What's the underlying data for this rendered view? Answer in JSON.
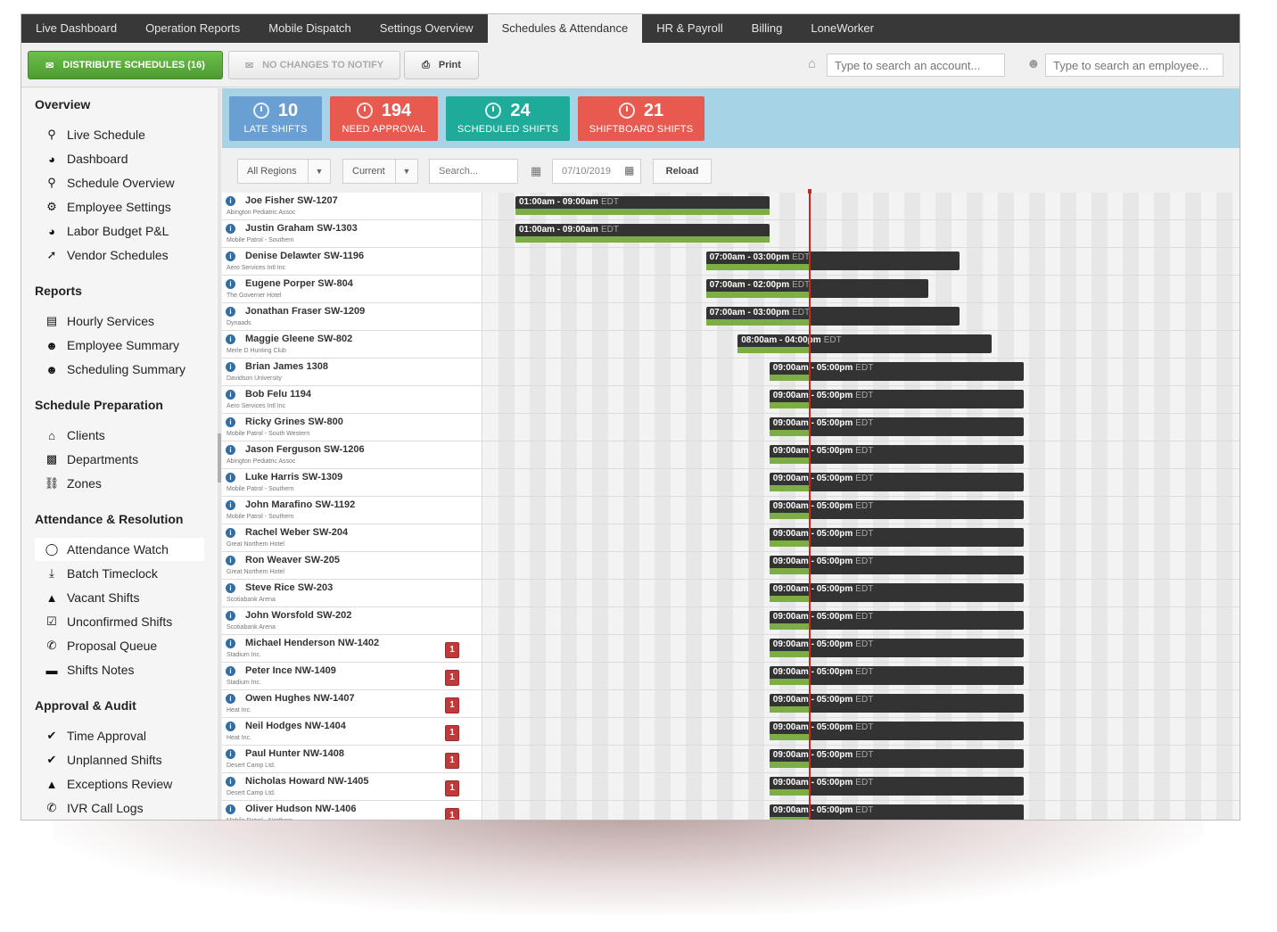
{
  "nav": {
    "tabs": [
      {
        "label": "Live Dashboard"
      },
      {
        "label": "Operation Reports"
      },
      {
        "label": "Mobile Dispatch"
      },
      {
        "label": "Settings Overview"
      },
      {
        "label": "Schedules & Attendance",
        "active": true
      },
      {
        "label": "HR & Payroll"
      },
      {
        "label": "Billing"
      },
      {
        "label": "LoneWorker"
      }
    ]
  },
  "toolbar": {
    "distribute_label": "DISTRIBUTE SCHEDULES (16)",
    "no_changes_label": "NO CHANGES TO NOTIFY",
    "print_label": "Print",
    "account_search_placeholder": "Type to search an account...",
    "employee_search_placeholder": "Type to search an employee..."
  },
  "sidebar": {
    "sections": [
      {
        "title": "Overview",
        "items": [
          {
            "label": "Live Schedule",
            "icon": "search-icon"
          },
          {
            "label": "Dashboard",
            "icon": "pie-chart-icon"
          },
          {
            "label": "Schedule Overview",
            "icon": "search-icon"
          },
          {
            "label": "Employee Settings",
            "icon": "gear-icon"
          },
          {
            "label": "Labor Budget P&L",
            "icon": "pie-chart-icon"
          },
          {
            "label": "Vendor Schedules",
            "icon": "share-icon"
          }
        ]
      },
      {
        "title": "Reports",
        "items": [
          {
            "label": "Hourly Services",
            "icon": "list-icon"
          },
          {
            "label": "Employee Summary",
            "icon": "user-icon"
          },
          {
            "label": "Scheduling Summary",
            "icon": "user-icon"
          }
        ]
      },
      {
        "title": "Schedule Preparation",
        "items": [
          {
            "label": "Clients",
            "icon": "home-icon"
          },
          {
            "label": "Departments",
            "icon": "building-icon"
          },
          {
            "label": "Zones",
            "icon": "car-icon"
          }
        ]
      },
      {
        "title": "Attendance & Resolution",
        "items": [
          {
            "label": "Attendance Watch",
            "icon": "eye-icon",
            "active": true
          },
          {
            "label": "Batch Timeclock",
            "icon": "download-icon"
          },
          {
            "label": "Vacant Shifts",
            "icon": "warning-icon"
          },
          {
            "label": "Unconfirmed Shifts",
            "icon": "checkbox-icon"
          },
          {
            "label": "Proposal Queue",
            "icon": "phone-icon"
          },
          {
            "label": "Shifts Notes",
            "icon": "folder-icon"
          }
        ]
      },
      {
        "title": "Approval & Audit",
        "items": [
          {
            "label": "Time Approval",
            "icon": "check-icon"
          },
          {
            "label": "Unplanned Shifts",
            "icon": "check-icon"
          },
          {
            "label": "Exceptions Review",
            "icon": "warning-icon"
          },
          {
            "label": "IVR Call Logs",
            "icon": "phone-icon"
          }
        ]
      }
    ]
  },
  "stats": [
    {
      "number": "10",
      "label": "LATE SHIFTS",
      "color": "#6a9fd3",
      "icon": "clock-icon"
    },
    {
      "number": "194",
      "label": "NEED APPROVAL",
      "color": "#e85a4f",
      "icon": "pie-chart-icon"
    },
    {
      "number": "24",
      "label": "SCHEDULED SHIFTS",
      "color": "#1fab9a",
      "icon": "clock-icon"
    },
    {
      "number": "21",
      "label": "SHIFTBOARD SHIFTS",
      "color": "#e85a4f",
      "icon": "clock-icon"
    }
  ],
  "filters": {
    "region": "All Regions",
    "period": "Current",
    "search_placeholder": "Search...",
    "date": "07/10/2019",
    "reload_label": "Reload"
  },
  "shifts": [
    {
      "name": "Joe Fisher SW-1207",
      "location": "Abington Pediatric Assoc",
      "time": "01:00am - 09:00am",
      "tz": "EDT",
      "start": 1,
      "end": 9,
      "badge": ""
    },
    {
      "name": "Justin Graham SW-1303",
      "location": "Mobile Patrol - Southern",
      "time": "01:00am - 09:00am",
      "tz": "EDT",
      "start": 1,
      "end": 9,
      "badge": ""
    },
    {
      "name": "Denise Delawter SW-1196",
      "location": "Aero Services Intl Inc",
      "time": "07:00am - 03:00pm",
      "tz": "EDT",
      "start": 7,
      "end": 15,
      "badge": ""
    },
    {
      "name": "Eugene Porper SW-804",
      "location": "The Governer Hotel",
      "time": "07:00am - 02:00pm",
      "tz": "EDT",
      "start": 7,
      "end": 14,
      "badge": ""
    },
    {
      "name": "Jonathan Fraser SW-1209",
      "location": "Dynaads",
      "time": "07:00am - 03:00pm",
      "tz": "EDT",
      "start": 7,
      "end": 15,
      "badge": ""
    },
    {
      "name": "Maggie Gleene SW-802",
      "location": "Merle D Hunting Club",
      "time": "08:00am - 04:00pm",
      "tz": "EDT",
      "start": 8,
      "end": 16,
      "badge": ""
    },
    {
      "name": "Brian James 1308",
      "location": "Davidson University",
      "time": "09:00am - 05:00pm",
      "tz": "EDT",
      "start": 9,
      "end": 17,
      "badge": ""
    },
    {
      "name": "Bob Felu 1194",
      "location": "Aero Services Intl Inc",
      "time": "09:00am - 05:00pm",
      "tz": "EDT",
      "start": 9,
      "end": 17,
      "badge": ""
    },
    {
      "name": "Ricky Grines SW-800",
      "location": "Mobile Patrol - South Western",
      "time": "09:00am - 05:00pm",
      "tz": "EDT",
      "start": 9,
      "end": 17,
      "badge": ""
    },
    {
      "name": "Jason Ferguson SW-1206",
      "location": "Abington Pediatric Assoc",
      "time": "09:00am - 05:00pm",
      "tz": "EDT",
      "start": 9,
      "end": 17,
      "badge": ""
    },
    {
      "name": "Luke Harris SW-1309",
      "location": "Mobile Patrol - Southern",
      "time": "09:00am - 05:00pm",
      "tz": "EDT",
      "start": 9,
      "end": 17,
      "badge": ""
    },
    {
      "name": "John Marafino SW-1192",
      "location": "Mobile Patrol - Southern",
      "time": "09:00am - 05:00pm",
      "tz": "EDT",
      "start": 9,
      "end": 17,
      "badge": ""
    },
    {
      "name": "Rachel Weber SW-204",
      "location": "Great Northern Hotel",
      "time": "09:00am - 05:00pm",
      "tz": "EDT",
      "start": 9,
      "end": 17,
      "badge": ""
    },
    {
      "name": "Ron Weaver SW-205",
      "location": "Great Northern Hotel",
      "time": "09:00am - 05:00pm",
      "tz": "EDT",
      "start": 9,
      "end": 17,
      "badge": ""
    },
    {
      "name": "Steve Rice SW-203",
      "location": "Scotiabank Arena",
      "time": "09:00am - 05:00pm",
      "tz": "EDT",
      "start": 9,
      "end": 17,
      "badge": ""
    },
    {
      "name": "John Worsfold SW-202",
      "location": "Scotiabank Arena",
      "time": "09:00am - 05:00pm",
      "tz": "EDT",
      "start": 9,
      "end": 17,
      "badge": ""
    },
    {
      "name": "Michael Henderson NW-1402",
      "location": "Stadium Inc.",
      "time": "09:00am - 05:00pm",
      "tz": "EDT",
      "start": 9,
      "end": 17,
      "badge": "1"
    },
    {
      "name": "Peter Ince NW-1409",
      "location": "Stadium Inc.",
      "time": "09:00am - 05:00pm",
      "tz": "EDT",
      "start": 9,
      "end": 17,
      "badge": "1"
    },
    {
      "name": "Owen Hughes NW-1407",
      "location": "Heat Inc.",
      "time": "09:00am - 05:00pm",
      "tz": "EDT",
      "start": 9,
      "end": 17,
      "badge": "1"
    },
    {
      "name": "Neil Hodges NW-1404",
      "location": "Heat Inc.",
      "time": "09:00am - 05:00pm",
      "tz": "EDT",
      "start": 9,
      "end": 17,
      "badge": "1"
    },
    {
      "name": "Paul Hunter NW-1408",
      "location": "Desert Camp Ltd.",
      "time": "09:00am - 05:00pm",
      "tz": "EDT",
      "start": 9,
      "end": 17,
      "badge": "1"
    },
    {
      "name": "Nicholas Howard NW-1405",
      "location": "Desert Camp Ltd.",
      "time": "09:00am - 05:00pm",
      "tz": "EDT",
      "start": 9,
      "end": 17,
      "badge": "1"
    },
    {
      "name": "Oliver Hudson NW-1406",
      "location": "Mobile Patrol - Northern",
      "time": "09:00am - 05:00pm",
      "tz": "EDT",
      "start": 9,
      "end": 17,
      "badge": "1"
    }
  ],
  "current_time": 10.25,
  "colors": {
    "accent_green": "#5cae3a",
    "shift_bar": "#333333",
    "progress": "#7dae45",
    "now_line": "#c62828",
    "stats_band": "#a6d4e6"
  }
}
